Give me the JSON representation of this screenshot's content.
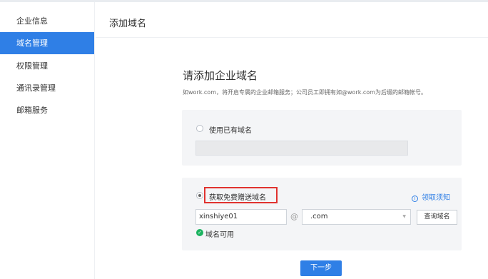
{
  "sidebar": {
    "items": [
      {
        "label": "企业信息"
      },
      {
        "label": "域名管理",
        "active": true
      },
      {
        "label": "权限管理"
      },
      {
        "label": "通讯录管理"
      },
      {
        "label": "邮箱服务"
      }
    ]
  },
  "header": {
    "title": "添加域名"
  },
  "main": {
    "title": "请添加企业域名",
    "description": "如work.com，将开启专属的企业邮箱服务；公司员工即拥有如@work.com为后缀的邮箱帐号。",
    "option_existing": {
      "label": "使用已有域名",
      "selected": false
    },
    "option_free": {
      "label": "获取免费赠送域名",
      "selected": true
    },
    "notice_link": "领取须知",
    "domain_input_value": "xinshiye01",
    "at_symbol": "@",
    "suffix_select_value": ".com",
    "query_button": "查询域名",
    "status_text": "域名可用",
    "next_button": "下一步"
  },
  "colors": {
    "accent": "#2f7fe6",
    "highlight_border": "#e0322f",
    "success": "#1bb35f"
  },
  "icons": {
    "notice": "info-circle-icon",
    "status": "check-circle-icon",
    "select": "chevron-down-icon"
  }
}
